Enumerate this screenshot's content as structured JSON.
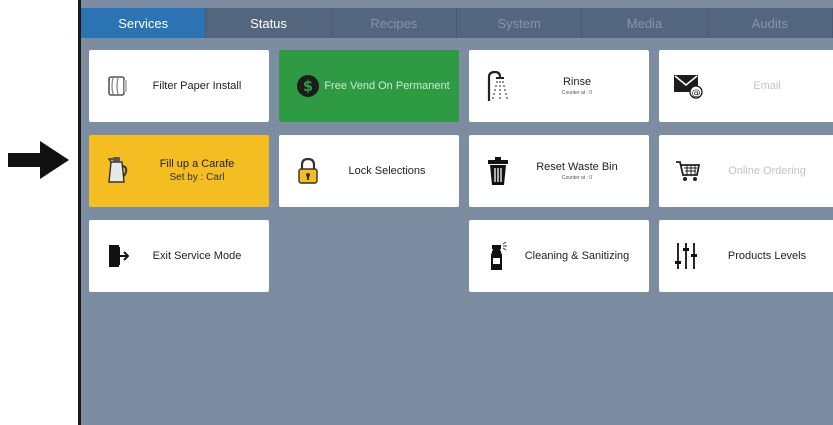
{
  "tabs": [
    {
      "label": "Services",
      "state": "active"
    },
    {
      "label": "Status",
      "state": "enabled"
    },
    {
      "label": "Recipes",
      "state": "disabled"
    },
    {
      "label": "System",
      "state": "disabled"
    },
    {
      "label": "Media",
      "state": "disabled"
    },
    {
      "label": "Audits",
      "state": "disabled"
    }
  ],
  "tiles": {
    "filter_paper": {
      "label": "Filter Paper Install",
      "icon": "filter-paper-icon"
    },
    "free_vend": {
      "label": "Free Vend On Permanent",
      "icon": "dollar-coin-icon",
      "color": "#2f9a44"
    },
    "rinse": {
      "label": "Rinse",
      "sub": "Counter at : 0",
      "icon": "shower-icon"
    },
    "email": {
      "label": "Email",
      "icon": "email-icon"
    },
    "fill_carafe": {
      "label": "Fill up a Carafe",
      "sub": "Set by : Carl",
      "icon": "carafe-icon",
      "color": "#f4bd22"
    },
    "lock_selections": {
      "label": "Lock Selections",
      "icon": "padlock-icon"
    },
    "reset_waste": {
      "label": "Reset Waste Bin",
      "sub": "Counter at : 0",
      "icon": "trash-bin-icon"
    },
    "online_ordering": {
      "label": "Online Ordering",
      "icon": "shopping-cart-icon"
    },
    "exit_service": {
      "label": "Exit Service Mode",
      "icon": "exit-door-icon"
    },
    "cleaning": {
      "label": "Cleaning & Sanitizing",
      "icon": "spray-bottle-icon"
    },
    "products_levels": {
      "label": "Products Levels",
      "icon": "level-sliders-icon"
    }
  },
  "colors": {
    "screen_bg": "#7d8da1",
    "tab_active": "#2b73b3",
    "tab_bar": "#54657e"
  }
}
